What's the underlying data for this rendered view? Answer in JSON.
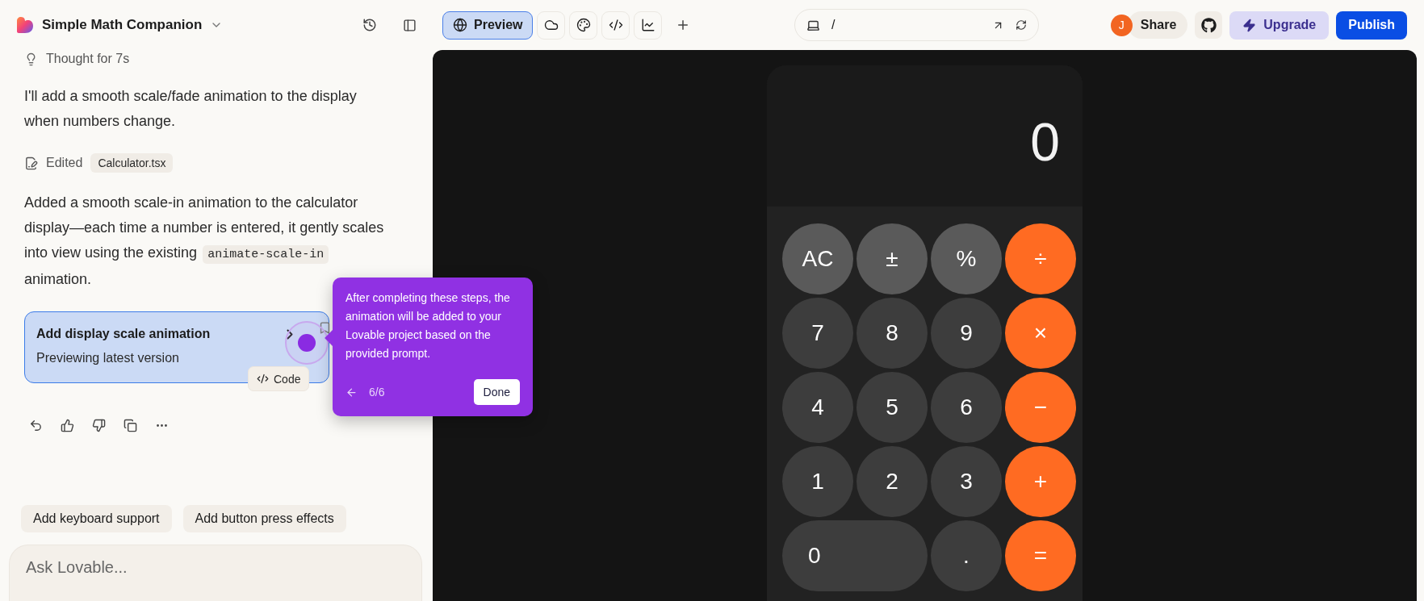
{
  "header": {
    "project_title": "Simple Math Companion"
  },
  "view_tabs": [
    {
      "label": "Preview",
      "selected": true
    },
    {
      "selected": false
    },
    {
      "selected": false
    },
    {
      "selected": false
    },
    {
      "selected": false
    }
  ],
  "url_bar": {
    "path": "/"
  },
  "user": {
    "avatar_initial": "J"
  },
  "buttons": {
    "share": "Share",
    "upgrade": "Upgrade",
    "publish": "Publish"
  },
  "chat": {
    "thought": "Thought for 7s",
    "message_1": "I'll add a smooth scale/fade animation to the display when numbers change.",
    "edit": {
      "label": "Edited",
      "file": "Calculator.tsx"
    },
    "message_2": {
      "before": "Added a smooth scale-in animation to the calculator display—each time a number is entered, it gently scales into view using the existing",
      "code": "animate-scale-in",
      "after": "animation."
    },
    "version_card": {
      "title": "Add display scale animation",
      "subtitle": "Previewing latest version",
      "selected": true
    },
    "code_chip": "Code",
    "suggestions": [
      "Add keyboard support",
      "Add button press effects"
    ],
    "input": {
      "placeholder": "Ask Lovable..."
    }
  },
  "tour": {
    "text": "After completing these steps, the animation will be added to your Lovable project based on the provided prompt.",
    "step": "6/6",
    "done": "Done"
  },
  "calculator": {
    "display": "0",
    "keys": [
      {
        "label": "AC",
        "kind": "function"
      },
      {
        "label": "±",
        "kind": "function"
      },
      {
        "label": "%",
        "kind": "function"
      },
      {
        "label": "÷",
        "kind": "operator"
      },
      {
        "label": "7",
        "kind": "digit"
      },
      {
        "label": "8",
        "kind": "digit"
      },
      {
        "label": "9",
        "kind": "digit"
      },
      {
        "label": "×",
        "kind": "operator"
      },
      {
        "label": "4",
        "kind": "digit"
      },
      {
        "label": "5",
        "kind": "digit"
      },
      {
        "label": "6",
        "kind": "digit"
      },
      {
        "label": "−",
        "kind": "operator"
      },
      {
        "label": "1",
        "kind": "digit"
      },
      {
        "label": "2",
        "kind": "digit"
      },
      {
        "label": "3",
        "kind": "digit"
      },
      {
        "label": "+",
        "kind": "operator"
      },
      {
        "label": "0",
        "kind": "wide"
      },
      {
        "label": ".",
        "kind": "digit"
      },
      {
        "label": "=",
        "kind": "operator"
      }
    ]
  }
}
